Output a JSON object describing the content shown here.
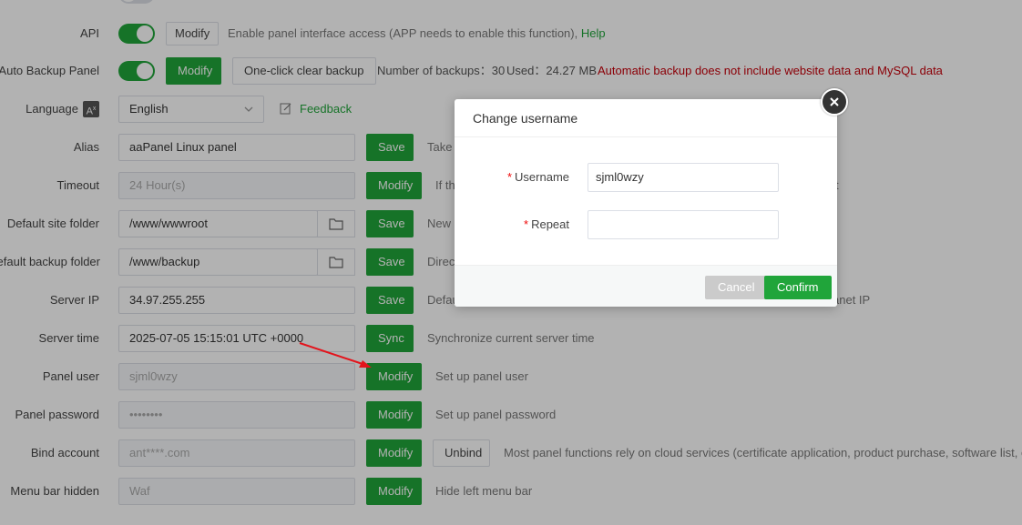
{
  "settings": {
    "api": {
      "label": "API",
      "modify": "Modify",
      "hint": "Enable panel interface access (APP needs to enable this function),",
      "help": "Help"
    },
    "auto_backup": {
      "label": "Auto Backup Panel",
      "modify": "Modify",
      "clear": "One-click clear backup",
      "count": "Number of backups：30",
      "used": "Used：24.27 MB",
      "warning": "Automatic backup does not include website data and MySQL data"
    },
    "language": {
      "label": "Language",
      "value": "English",
      "feedback": "Feedback"
    },
    "alias": {
      "label": "Alias",
      "value": "aaPanel Linux panel",
      "button": "Save",
      "hint": "Take a"
    },
    "timeout": {
      "label": "Timeout",
      "value": "24 Hour(s)",
      "button": "Modify",
      "hint": "If th",
      "hint_tail": "t"
    },
    "site_folder": {
      "label": "Default site folder",
      "value": "/www/wwwroot",
      "button": "Save",
      "hint": "New c"
    },
    "backup_folder": {
      "label": "Default backup folder",
      "value": "/www/backup",
      "button": "Save",
      "hint": "Direct"
    },
    "server_ip": {
      "label": "Server IP",
      "value": "34.97.255.255",
      "button": "Save",
      "hint": "Defau",
      "hint_tail": "anet IP"
    },
    "server_time": {
      "label": "Server time",
      "value": "2025-07-05 15:15:01 UTC +0000",
      "button": "Sync",
      "hint": "Synchronize current server time"
    },
    "panel_user": {
      "label": "Panel user",
      "value": "sjml0wzy",
      "button": "Modify",
      "hint": "Set up panel user"
    },
    "panel_password": {
      "label": "Panel password",
      "value": "••••••••",
      "button": "Modify",
      "hint": "Set up panel password"
    },
    "bind_account": {
      "label": "Bind account",
      "value": "ant****.com",
      "button": "Modify",
      "unbind": "Unbind",
      "hint": "Most panel functions rely on cloud services (certificate application, product purchase, software list, etc.)."
    },
    "menu_bar": {
      "label": "Menu bar hidden",
      "value": "Waf",
      "button": "Modify",
      "hint": "Hide left menu bar"
    }
  },
  "modal": {
    "title": "Change username",
    "username_label": "Username",
    "username_value": "sjml0wzy",
    "repeat_label": "Repeat",
    "repeat_value": "",
    "required_mark": "*",
    "cancel": "Cancel",
    "confirm": "Confirm"
  },
  "colors": {
    "accent": "#20a53a",
    "warning": "#c7000b",
    "help": "#20a53a"
  },
  "icons": [
    "close-icon",
    "folder-icon",
    "translate-icon",
    "edit-icon",
    "chevron-down-icon"
  ]
}
